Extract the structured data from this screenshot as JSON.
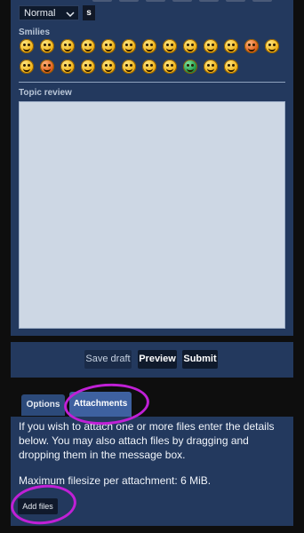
{
  "editor": {
    "font_size_select": "Normal",
    "small_button": "s"
  },
  "smilies": {
    "label": "Smilies",
    "row1": [
      "laugh",
      "grin",
      "wink",
      "smile",
      "shocked",
      "eek",
      "confused",
      "cool",
      "razz",
      "rolleyes",
      "lol",
      "mad",
      "neutral"
    ],
    "row2": [
      "twisted",
      "evil",
      "sad",
      "exclaim",
      "question",
      "surprised",
      "arrow",
      "idea",
      "green",
      "geek",
      "uber-geek"
    ]
  },
  "review": {
    "label": "Topic review"
  },
  "actions": {
    "save_draft": "Save draft",
    "preview": "Preview",
    "submit": "Submit"
  },
  "tabs": {
    "options": "Options",
    "attachments": "Attachments"
  },
  "attachments": {
    "description": "If you wish to attach one or more files enter the details below. You may also attach files by dragging and dropping them in the message box.",
    "max_size": "Maximum filesize per attachment: 6 MiB.",
    "add_files": "Add files"
  },
  "colors": {
    "panel": "#23395e",
    "annotation": "#c020d6"
  }
}
